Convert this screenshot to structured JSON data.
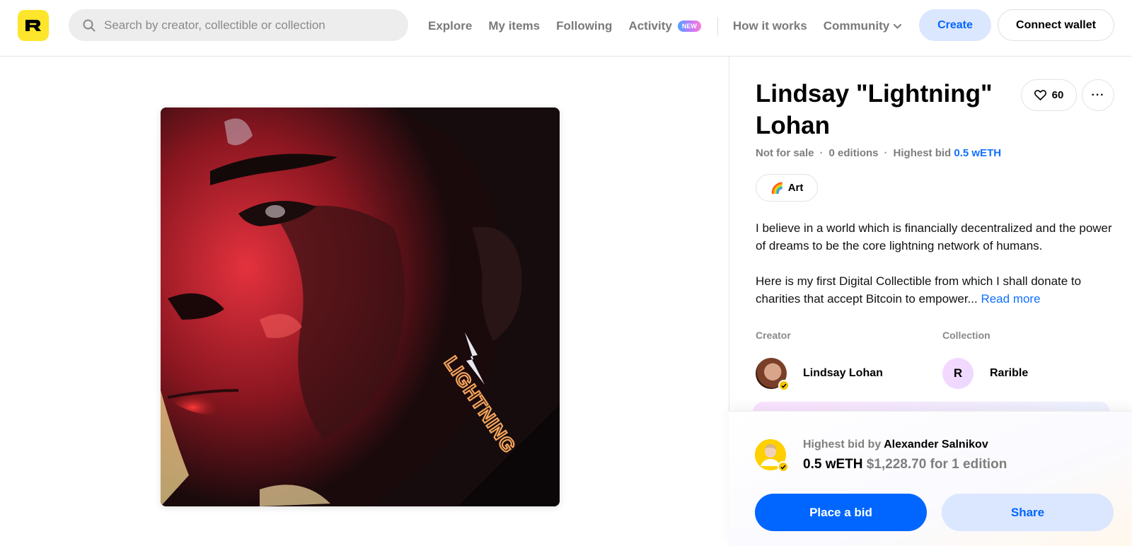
{
  "header": {
    "logo_letter": "R",
    "search": {
      "placeholder": "Search by creator, collectible or collection"
    },
    "nav": {
      "explore": "Explore",
      "my_items": "My items",
      "following": "Following",
      "activity": "Activity",
      "activity_badge": "NEW",
      "how_it_works": "How it works",
      "community": "Community"
    },
    "create_label": "Create",
    "connect_label": "Connect wallet"
  },
  "item": {
    "title": "Lindsay \"Lightning\" Lohan",
    "likes": "60",
    "more_label": "···",
    "status": "Not for sale",
    "editions": "0 editions",
    "highest_bid_label": "Highest bid",
    "highest_bid_value": "0.5 wETH",
    "tag_emoji": "🌈",
    "tag_label": "Art",
    "description_p1": "I believe in a world which is financially decentralized and the power of dreams to be the core lightning network of humans.",
    "description_p2": "Here is my first Digital Collectible from which I shall donate to charities that accept Bitcoin to empower...",
    "read_more": "Read more",
    "artwork_text": "LIGHTNING"
  },
  "creator": {
    "label": "Creator",
    "name": "Lindsay Lohan"
  },
  "collection": {
    "label": "Collection",
    "name": "Rarible",
    "logo_letter": "R"
  },
  "bid": {
    "prefix": "Highest bid by",
    "bidder": "Alexander Salnikov",
    "amount": "0.5 wETH",
    "usd": "$1,228.70",
    "suffix": "for 1 edition",
    "place_bid_label": "Place a bid",
    "share_label": "Share"
  },
  "colors": {
    "brand_yellow": "#fde52b",
    "accent_blue": "#0066ff",
    "soft_blue": "#dbe6ff",
    "verified": "#f5c400"
  }
}
